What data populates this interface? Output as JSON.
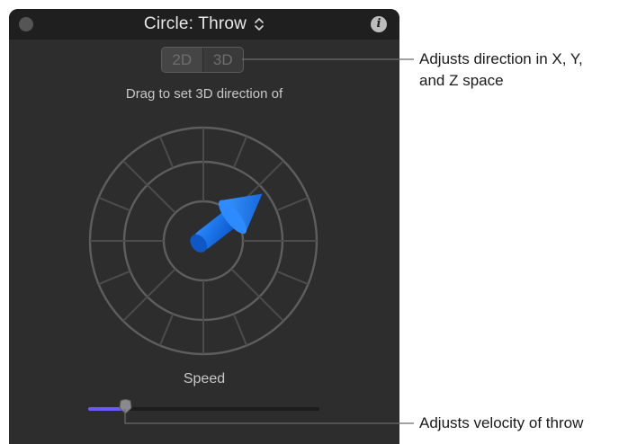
{
  "hud": {
    "title": "Circle: Throw",
    "mode_buttons": [
      "2D",
      "3D"
    ],
    "selected_mode": "3D",
    "instruction": "Drag to set 3D direction of",
    "speed_label": "Speed",
    "speed_value_fraction": 0.16
  },
  "callouts": {
    "direction_line1": "Adjusts direction in X, Y,",
    "direction_line2": "and Z space",
    "velocity": "Adjusts velocity of throw"
  },
  "colors": {
    "accent": "#6a5af9",
    "arrow": "#1e7bff"
  },
  "icons": {
    "close": "close-dot-icon",
    "popup": "updown-chevron-icon",
    "info": "info-icon"
  }
}
